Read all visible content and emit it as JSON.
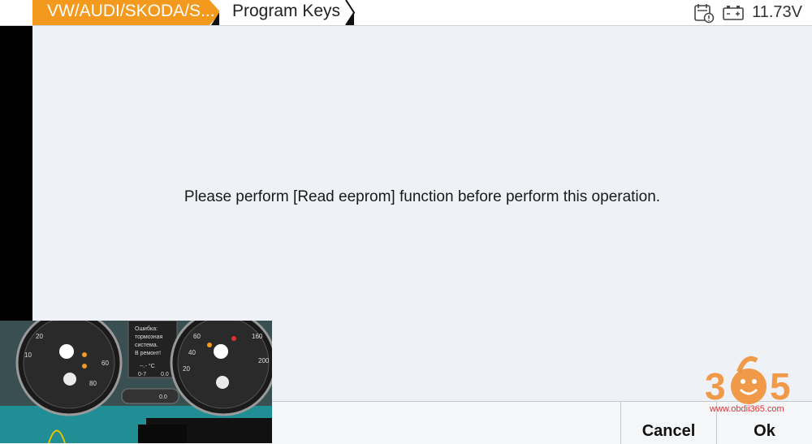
{
  "breadcrumb": {
    "root": "VW/AUDI/SKODA/S...",
    "current": "Program Keys"
  },
  "status": {
    "calendar_icon": "calendar-alert-icon",
    "battery_icon": "battery-icon",
    "voltage": "11.73V"
  },
  "message": "Please perform [Read eeprom] function before perform this operation.",
  "buttons": {
    "cancel": "Cancel",
    "ok": "Ok"
  },
  "watermark": {
    "digits": "365",
    "url": "www.obdii365.com"
  },
  "video_overlay": {
    "screen_lines": [
      "Ошибка:",
      "тормозная",
      "система.",
      "В ремонт!"
    ],
    "temp": "--.- °C",
    "range_left": "0-7",
    "range_right": "0.0",
    "button_label": "0.0"
  },
  "colors": {
    "accent": "#f39a1e",
    "panel_bg": "#eef1f5",
    "watermark": "#f08a2a"
  }
}
